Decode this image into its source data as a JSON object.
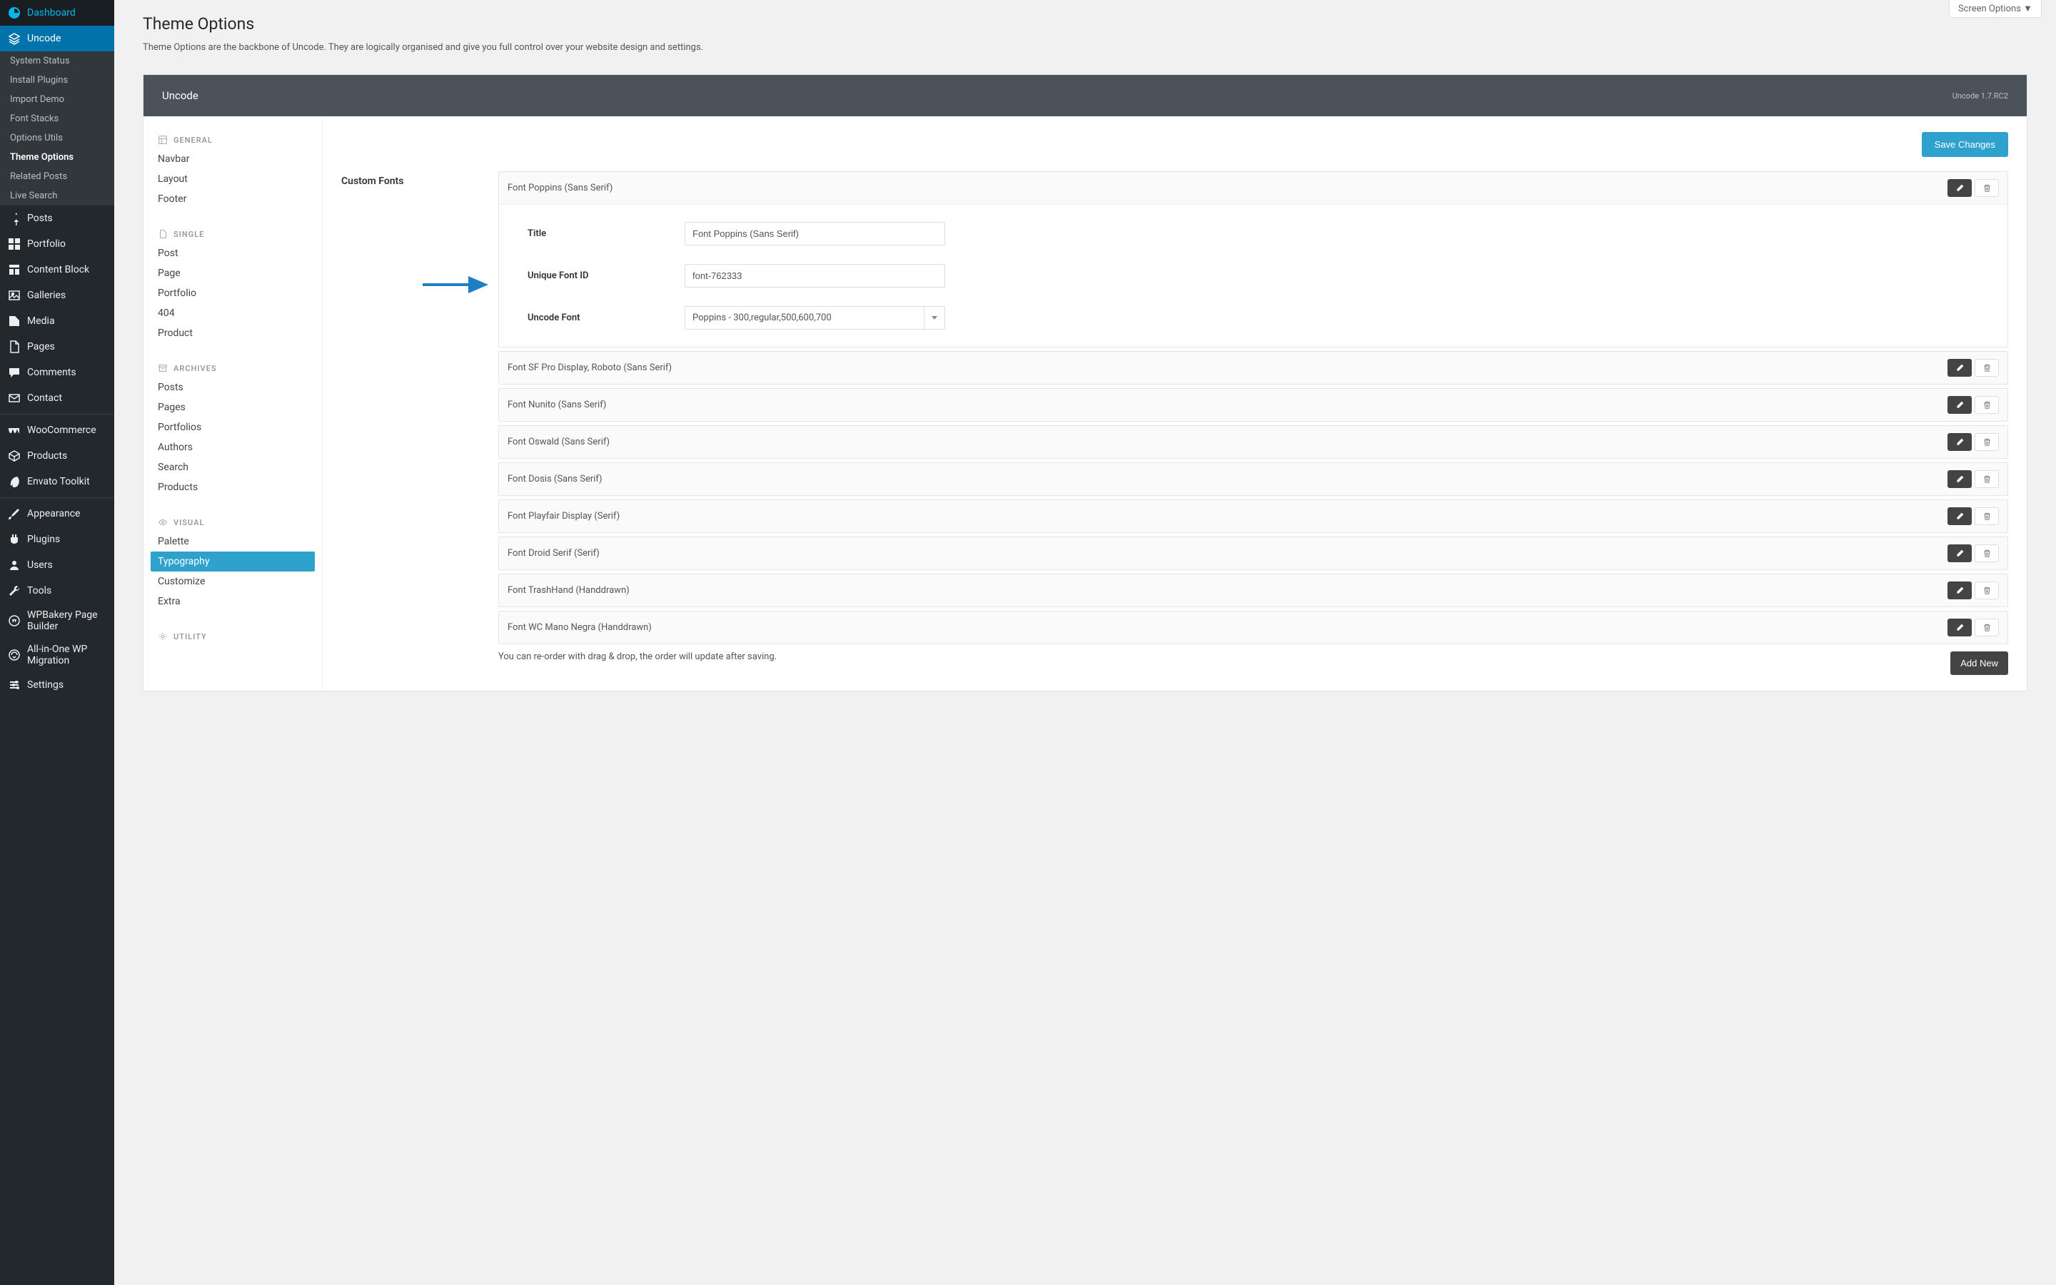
{
  "screen_options": "Screen Options ▼",
  "page": {
    "title": "Theme Options",
    "desc": "Theme Options are the backbone of Uncode. They are logically organised and give you full control over your website design and settings."
  },
  "admin_menu": {
    "dashboard": "Dashboard",
    "uncode": "Uncode",
    "uncode_sub": [
      "System Status",
      "Install Plugins",
      "Import Demo",
      "Font Stacks",
      "Options Utils",
      "Theme Options",
      "Related Posts",
      "Live Search"
    ],
    "posts": "Posts",
    "portfolio": "Portfolio",
    "content_block": "Content Block",
    "galleries": "Galleries",
    "media": "Media",
    "pages": "Pages",
    "comments": "Comments",
    "contact": "Contact",
    "woocommerce": "WooCommerce",
    "products": "Products",
    "envato": "Envato Toolkit",
    "appearance": "Appearance",
    "plugins": "Plugins",
    "users": "Users",
    "tools": "Tools",
    "wpbakery": "WPBakery Page Builder",
    "aio": "All-in-One WP Migration",
    "settings": "Settings"
  },
  "panel": {
    "title": "Uncode",
    "version": "Uncode 1.7.RC2",
    "save": "Save Changes",
    "add_new": "Add New",
    "reorder_note": "You can re-order with drag & drop, the order will update after saving."
  },
  "opt_groups": {
    "general": {
      "label": "GENERAL",
      "items": [
        "Navbar",
        "Layout",
        "Footer"
      ]
    },
    "single": {
      "label": "SINGLE",
      "items": [
        "Post",
        "Page",
        "Portfolio",
        "404",
        "Product"
      ]
    },
    "archives": {
      "label": "ARCHIVES",
      "items": [
        "Posts",
        "Pages",
        "Portfolios",
        "Authors",
        "Search",
        "Products"
      ]
    },
    "visual": {
      "label": "VISUAL",
      "items": [
        "Palette",
        "Typography",
        "Customize",
        "Extra"
      ]
    },
    "utility": {
      "label": "UTILITY"
    }
  },
  "section": {
    "label": "Custom Fonts",
    "expanded": {
      "title_label": "Title",
      "title_value": "Font Poppins (Sans Serif)",
      "id_label": "Unique Font ID",
      "id_value": "font-762333",
      "font_label": "Uncode Font",
      "font_value": "Poppins - 300,regular,500,600,700"
    },
    "fonts": [
      "Font Poppins (Sans Serif)",
      "Font SF Pro Display, Roboto (Sans Serif)",
      "Font Nunito (Sans Serif)",
      "Font Oswald (Sans Serif)",
      "Font Dosis (Sans Serif)",
      "Font Playfair Display (Serif)",
      "Font Droid Serif (Serif)",
      "Font TrashHand (Handdrawn)",
      "Font WC Mano Negra (Handdrawn)"
    ]
  }
}
